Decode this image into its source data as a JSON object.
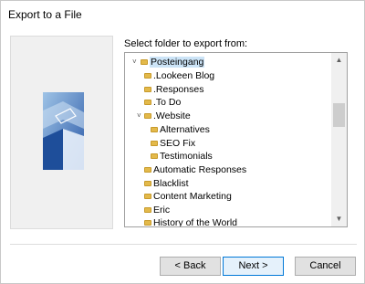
{
  "window": {
    "title": "Export to a File"
  },
  "prompt": "Select folder to export from:",
  "tree": {
    "nodes": [
      {
        "label": "Posteingang",
        "expanded": true,
        "selected": true
      },
      {
        "label": ".Lookeen Blog"
      },
      {
        "label": ".Responses"
      },
      {
        "label": ".To Do"
      },
      {
        "label": ".Website",
        "expanded": true
      },
      {
        "label": "Alternatives"
      },
      {
        "label": "SEO Fix"
      },
      {
        "label": "Testimonials"
      },
      {
        "label": "Automatic Responses"
      },
      {
        "label": "Blacklist"
      },
      {
        "label": "Content Marketing"
      },
      {
        "label": "Eric"
      },
      {
        "label": "History of the World"
      }
    ]
  },
  "icons": {
    "expanded": "chevron-down-icon",
    "folder": "folder-icon",
    "scroll_up": "scroll-up-arrow-icon",
    "scroll_down": "scroll-down-arrow-icon"
  },
  "buttons": {
    "back": "< Back",
    "next": "Next >",
    "cancel": "Cancel"
  },
  "colors": {
    "selection": "#cce4f7",
    "folder": "#e3b94a",
    "primary_border": "#0078d7"
  }
}
